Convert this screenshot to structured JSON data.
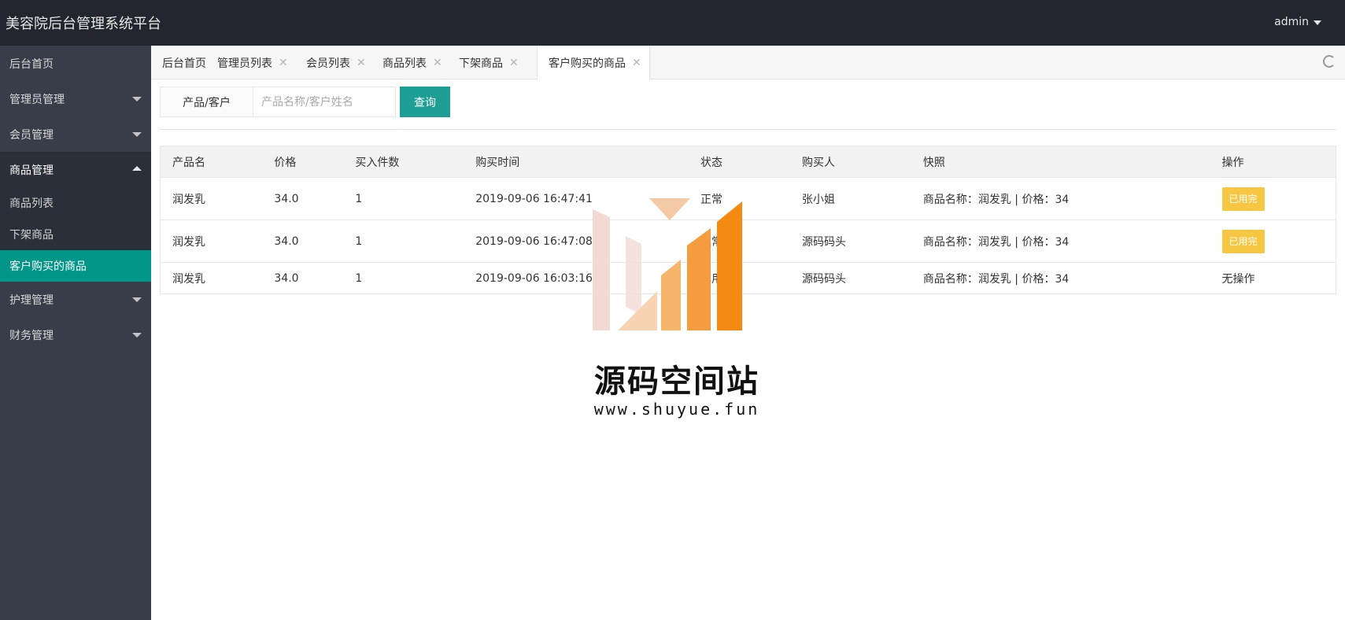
{
  "header": {
    "title": "美容院后台管理系统平台",
    "user": "admin"
  },
  "sidebar": {
    "items": [
      {
        "label": "后台首页"
      },
      {
        "label": "管理员管理"
      },
      {
        "label": "会员管理"
      },
      {
        "label": "商品管理"
      },
      {
        "label": "护理管理"
      },
      {
        "label": "财务管理"
      }
    ],
    "sub_items": [
      {
        "label": "商品列表"
      },
      {
        "label": "下架商品"
      },
      {
        "label": "客户购买的商品"
      }
    ]
  },
  "tabs": [
    {
      "label": "后台首页"
    },
    {
      "label": "管理员列表"
    },
    {
      "label": "会员列表"
    },
    {
      "label": "商品列表"
    },
    {
      "label": "下架商品"
    },
    {
      "label": "客户购买的商品"
    }
  ],
  "search": {
    "label": "产品/客户",
    "placeholder": "产品名称/客户姓名",
    "button": "查询"
  },
  "table": {
    "headers": [
      "产品名",
      "价格",
      "买入件数",
      "购买时间",
      "状态",
      "购买人",
      "快照",
      "操作"
    ],
    "rows": [
      {
        "product": "润发乳",
        "price": "34.0",
        "qty": "1",
        "time": "2019-09-06 16:47:41",
        "status": "正常",
        "buyer": "张小姐",
        "snapshot": "商品名称：润发乳 | 价格：34",
        "action": "已用完"
      },
      {
        "product": "润发乳",
        "price": "34.0",
        "qty": "1",
        "time": "2019-09-06 16:47:08",
        "status": "正常",
        "buyer": "源码码头",
        "snapshot": "商品名称：润发乳 | 价格：34",
        "action": "已用完"
      },
      {
        "product": "润发乳",
        "price": "34.0",
        "qty": "1",
        "time": "2019-09-06 16:03:16",
        "status": "已用完",
        "buyer": "源码码头",
        "snapshot": "商品名称：润发乳 | 价格：34",
        "action": "无操作"
      }
    ]
  },
  "watermark": {
    "title": "源码空间站",
    "url": "www.shuyue.fun"
  },
  "colors": {
    "topbar": "#23262e",
    "sidebar": "#393d49",
    "accent": "#009688",
    "button": "#1e9f95",
    "badge": "#f7c643"
  }
}
